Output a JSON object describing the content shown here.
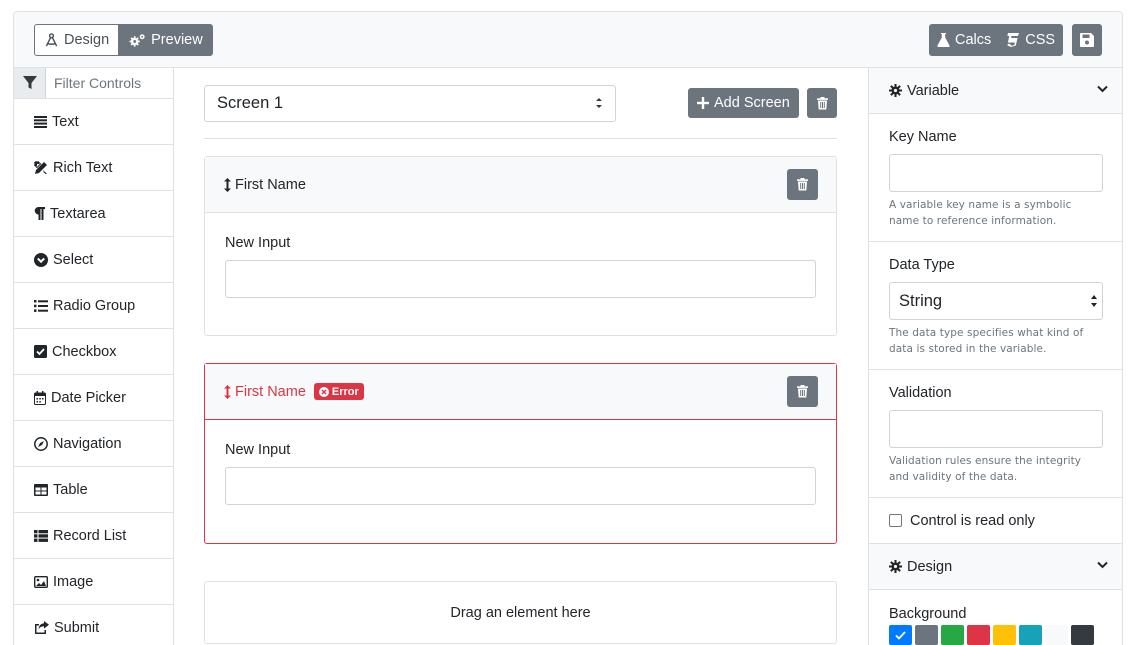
{
  "topbar": {
    "design_label": "Design",
    "preview_label": "Preview",
    "calcs_label": "Calcs",
    "css_label": "CSS"
  },
  "sidebar": {
    "filter_placeholder": "Filter Controls",
    "controls": [
      {
        "label": "Text",
        "icon": "align-justify-icon"
      },
      {
        "label": "Rich Text",
        "icon": "pencil-ruler-icon"
      },
      {
        "label": "Textarea",
        "icon": "paragraph-icon"
      },
      {
        "label": "Select",
        "icon": "chevron-circle-down-icon"
      },
      {
        "label": "Radio Group",
        "icon": "list-icon"
      },
      {
        "label": "Checkbox",
        "icon": "check-square-icon"
      },
      {
        "label": "Date Picker",
        "icon": "calendar-icon"
      },
      {
        "label": "Navigation",
        "icon": "compass-icon"
      },
      {
        "label": "Table",
        "icon": "table-icon"
      },
      {
        "label": "Record List",
        "icon": "th-list-icon"
      },
      {
        "label": "Image",
        "icon": "image-icon"
      },
      {
        "label": "Submit",
        "icon": "share-square-icon"
      }
    ]
  },
  "canvas": {
    "screen_selected": "Screen 1",
    "add_screen_label": "Add Screen",
    "cards": [
      {
        "title": "First Name",
        "input_label": "New Input",
        "error": false
      },
      {
        "title": "First Name",
        "input_label": "New Input",
        "error": true,
        "badge": "Error"
      }
    ],
    "dropzone_text": "Drag an element here"
  },
  "inspector": {
    "variable_section": "Variable",
    "key_name_label": "Key Name",
    "key_name_help": "A variable key name is a symbolic name to reference information.",
    "data_type_label": "Data Type",
    "data_type_value": "String",
    "data_type_help": "The data type specifies what kind of data is stored in the variable.",
    "validation_label": "Validation",
    "validation_help": "Validation rules ensure the integrity and validity of the data.",
    "readonly_label": "Control is read only",
    "design_section": "Design",
    "background_label": "Background",
    "swatches": [
      "#007bff",
      "#6c757d",
      "#28a745",
      "#dc3545",
      "#ffc107",
      "#17a2b8",
      "#f8f9fa",
      "#343a40"
    ]
  }
}
